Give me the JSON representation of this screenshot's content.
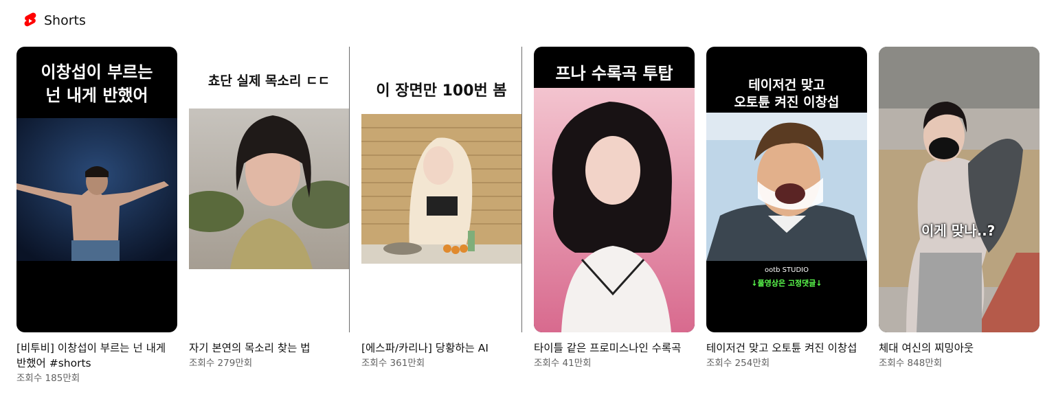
{
  "shelf": {
    "title": "Shorts",
    "logo_icon": "youtube-shorts-icon",
    "brand_color": "#ff0000"
  },
  "shorts": [
    {
      "title": "[비투비] 이창섭이 부르는 넌 내게 반했어 #shorts",
      "views": "조회수 185만회",
      "caption_line1": "이창섭이 부르는",
      "caption_line2": "넌 내게 반했어"
    },
    {
      "title": "자기 본연의 목소리 찾는 법",
      "views": "조회수 279만회",
      "caption_line1": "쵸단 실제 목소리 ㄷㄷ"
    },
    {
      "title": "[에스파/카리나] 당황하는 AI",
      "views": "조회수 361만회",
      "caption_line1": "이 장면만 100번 봄"
    },
    {
      "title": "타이틀 같은 프로미스나인 수록곡",
      "views": "조회수 41만회",
      "caption_line1": "프나 수록곡 투탑"
    },
    {
      "title": "테이저건 맞고 오토튠 켜진 이창섭",
      "views": "조회수 254만회",
      "caption_line1": "테이저건 맞고",
      "caption_line2": "오토튠 켜진 이창섭",
      "studio_label": "ootb STUDIO",
      "subtitle": "↓풀영상은 고정댓글↓"
    },
    {
      "title": "체대 여신의 찌밍아웃",
      "views": "조회수 848만회",
      "overlay": "이게 맞나..?"
    }
  ]
}
